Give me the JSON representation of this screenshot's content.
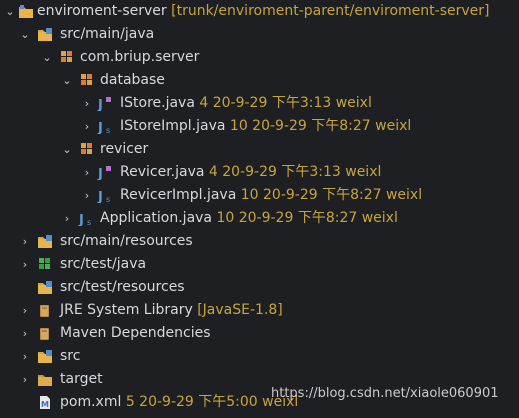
{
  "tree": {
    "project": {
      "name": "enviroment-server",
      "decoration": "[trunk/enviroment-parent/enviroment-server]"
    },
    "src_main_java": {
      "label": "src/main/java"
    },
    "package": {
      "label": "com.briup.server"
    },
    "database": {
      "label": "database"
    },
    "istore": {
      "name": "IStore.java",
      "decoration": "4  20-9-29 下午3:13  weixl"
    },
    "istoreimpl": {
      "name": "IStoreImpl.java",
      "decoration": "10  20-9-29 下午8:27  weixl"
    },
    "revicer_pkg": {
      "label": "revicer"
    },
    "revicer": {
      "name": "Revicer.java",
      "decoration": "4  20-9-29 下午3:13  weixl"
    },
    "revicerimpl": {
      "name": "RevicerImpl.java",
      "decoration": "10  20-9-29 下午8:27  weixl"
    },
    "application": {
      "name": "Application.java",
      "decoration": "10  20-9-29 下午8:27  weixl"
    },
    "src_main_resources": {
      "label": "src/main/resources"
    },
    "src_test_java": {
      "label": "src/test/java"
    },
    "src_test_resources": {
      "label": "src/test/resources"
    },
    "jre": {
      "name": "JRE System Library",
      "decoration": "[JavaSE-1.8]"
    },
    "maven": {
      "label": "Maven Dependencies"
    },
    "src": {
      "label": "src"
    },
    "target": {
      "label": "target"
    },
    "pom": {
      "name": "pom.xml",
      "decoration": "5  20-9-29 下午5:00  weixl"
    }
  },
  "watermark": "https://blog.csdn.net/xiaole060901",
  "colors": {
    "background": "#1e1f22",
    "text": "#d6d9dd",
    "decoration": "#c8a53c",
    "folder": "#d9a441",
    "package": "#d9a441",
    "java": "#5d9bd6"
  },
  "icons": {
    "project": "project-folder-icon",
    "source_folder": "source-folder-icon",
    "package": "package-icon",
    "java_interface": "java-interface-icon",
    "java_class": "java-class-icon",
    "library": "library-icon",
    "folder": "folder-icon",
    "xml": "xml-file-icon"
  }
}
